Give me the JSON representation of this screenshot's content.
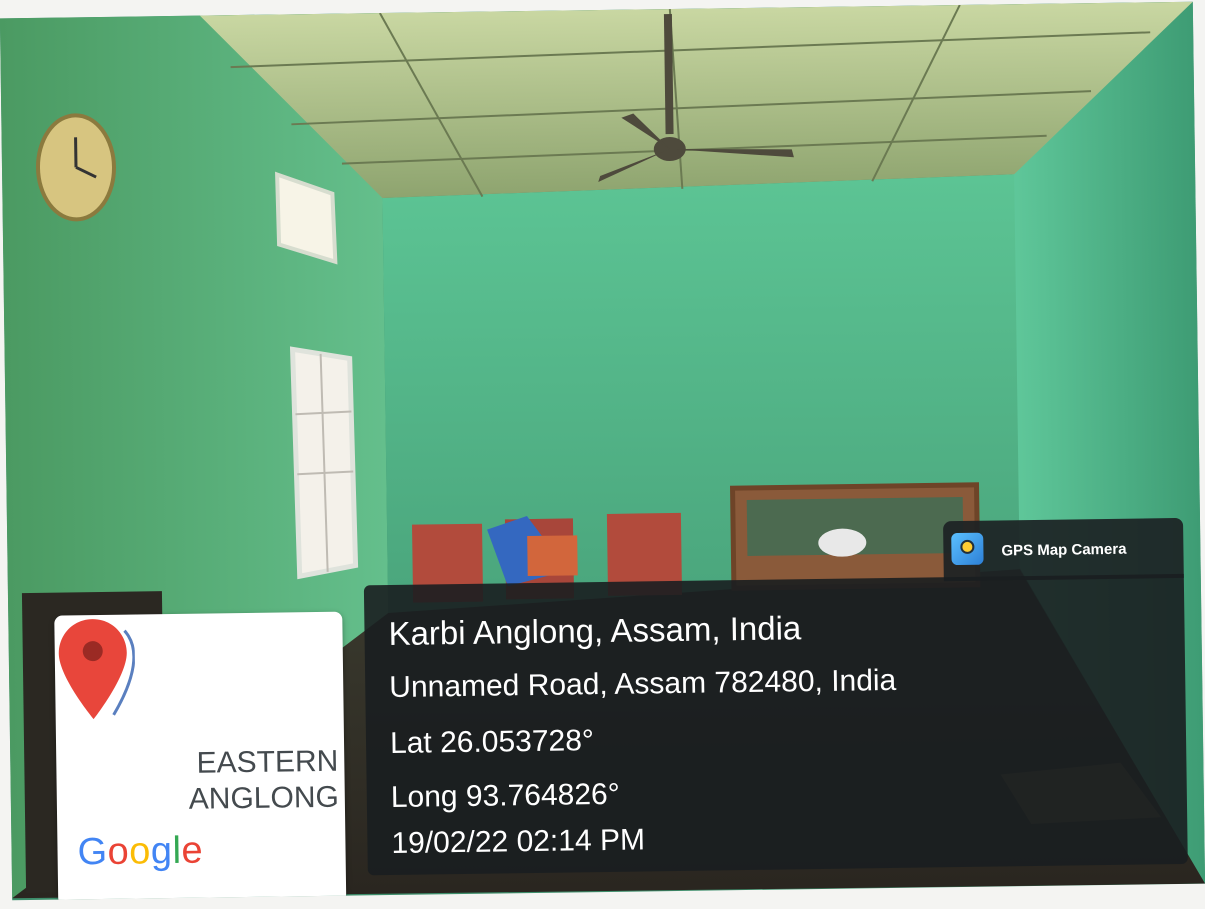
{
  "badge": {
    "title": "GPS Map Camera",
    "logo_icon": "gps-map-camera-icon"
  },
  "location": {
    "place": "Karbi Anglong, Assam, India",
    "address": "Unnamed Road, Assam 782480, India",
    "latitude": "Lat 26.053728°",
    "longitude": "Long 93.764826°",
    "datetime": "19/02/22 02:14 PM"
  },
  "map": {
    "pin_icon": "map-pin-icon",
    "place_line1": "EASTERN",
    "place_line2": "ANGLONG",
    "brand_letters": [
      "G",
      "o",
      "o",
      "g",
      "l",
      "e"
    ]
  },
  "colors": {
    "wall": "#3f9a74",
    "overlay": "#1a1e20",
    "pin": "#e8463b",
    "google_blue": "#4285f4",
    "google_red": "#ea4335",
    "google_yellow": "#fbbc05",
    "google_green": "#34a853"
  }
}
